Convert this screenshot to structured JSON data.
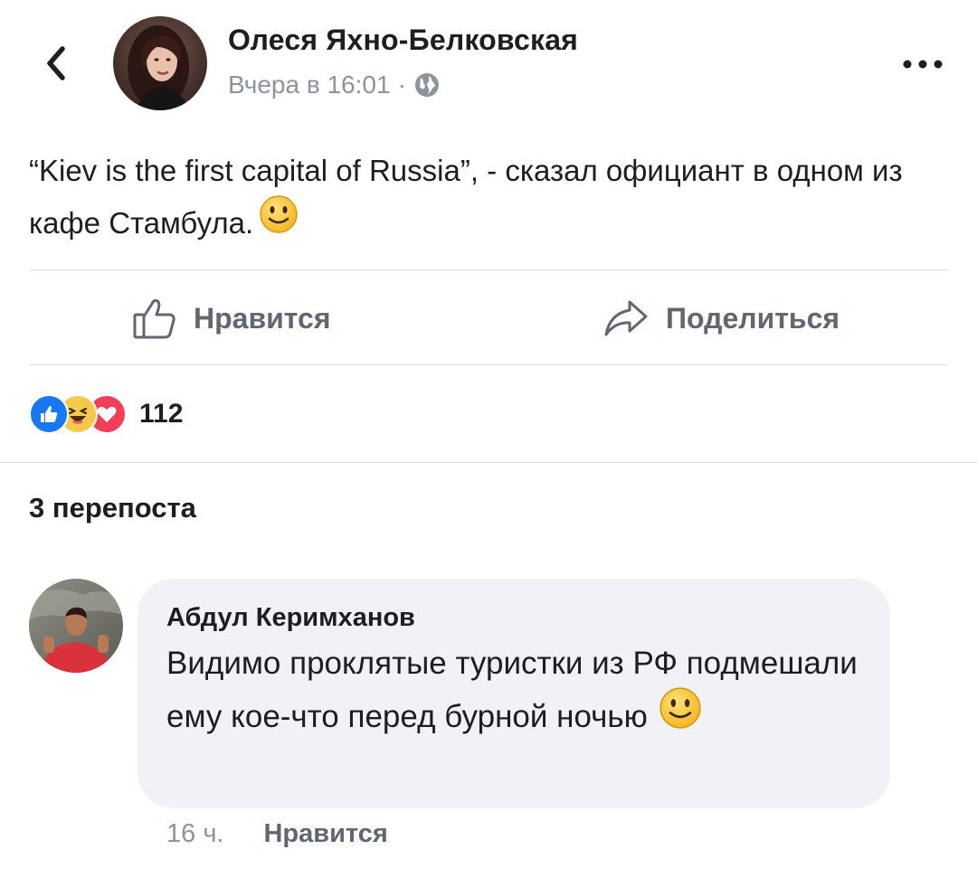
{
  "header": {
    "author_name": "Олеся Яхно-Белковская",
    "timestamp": "Вчера в 16:01",
    "separator": "·",
    "privacy_icon": "globe-icon",
    "back_icon": "chevron-left-icon",
    "more_icon": "ellipsis-icon"
  },
  "post": {
    "text": "“Kiev is the first capital of Russia”, - сказал официант в одном из кафе Стамбула.",
    "emoji": "slightly-smiling-face-emoji"
  },
  "actions": {
    "like_label": "Нравится",
    "share_label": "Поделиться"
  },
  "reactions": {
    "icons": [
      "like-reaction",
      "haha-reaction",
      "love-reaction"
    ],
    "count": "112"
  },
  "shares": {
    "label": "3 перепоста"
  },
  "comment": {
    "author": "Абдул Керимханов",
    "text": "Видимо проклятые туристки из РФ подмешали ему кое-что перед бурной ночью",
    "emoji": "slightly-smiling-face-emoji",
    "time": "16 ч.",
    "like_label": "Нравится"
  },
  "colors": {
    "text_primary": "#1c1e21",
    "text_secondary": "#8d949e",
    "action_gray": "#606770",
    "like_blue": "#1877f2",
    "love_red": "#f33e58",
    "haha_yellow": "#f7c94a",
    "bubble_bg": "#f0f2f5",
    "divider": "#dadde1"
  }
}
